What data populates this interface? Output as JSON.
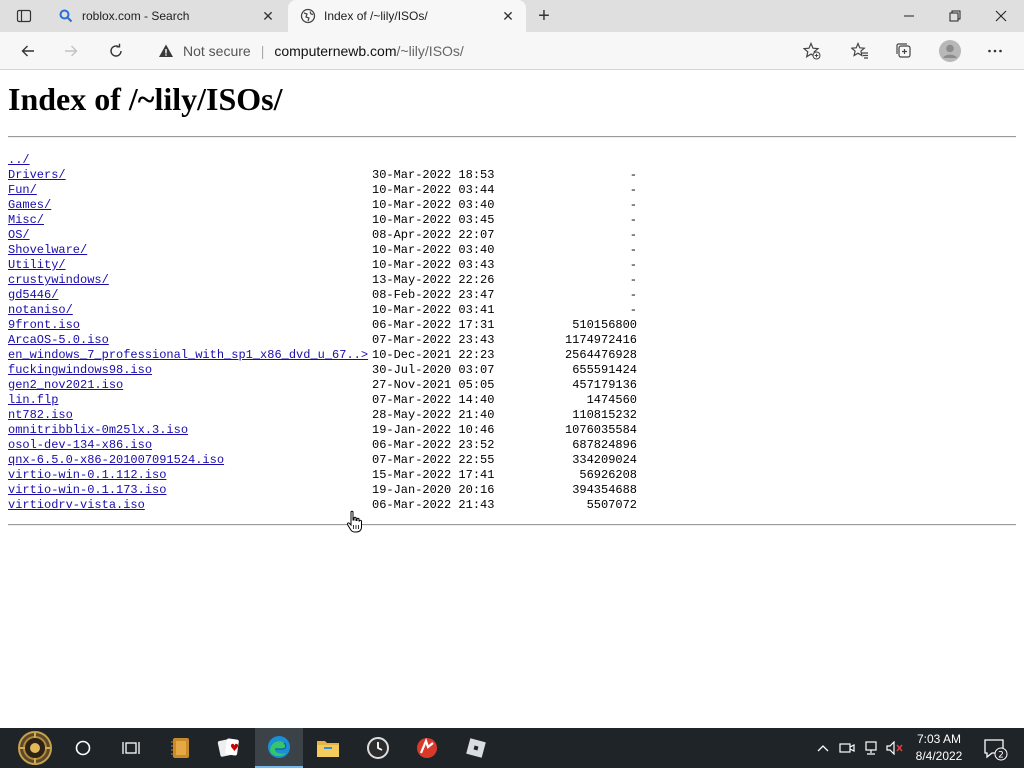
{
  "browser": {
    "tabs": [
      {
        "title": "roblox.com - Search",
        "active": false,
        "icon": "search-icon"
      },
      {
        "title": "Index of /~lily/ISOs/",
        "active": true,
        "icon": "globe-icon"
      }
    ],
    "address_bar": {
      "security_label": "Not secure",
      "url_host": "computernewb.com",
      "url_path": "/~lily/ISOs/"
    }
  },
  "page": {
    "title": "Index of /~lily/ISOs/",
    "parent_link": "../",
    "entries": [
      {
        "name": "Drivers/",
        "date": "30-Mar-2022 18:53",
        "size": "-"
      },
      {
        "name": "Fun/",
        "date": "10-Mar-2022 03:44",
        "size": "-"
      },
      {
        "name": "Games/",
        "date": "10-Mar-2022 03:40",
        "size": "-"
      },
      {
        "name": "Misc/",
        "date": "10-Mar-2022 03:45",
        "size": "-"
      },
      {
        "name": "OS/",
        "date": "08-Apr-2022 22:07",
        "size": "-"
      },
      {
        "name": "Shovelware/",
        "date": "10-Mar-2022 03:40",
        "size": "-"
      },
      {
        "name": "Utility/",
        "date": "10-Mar-2022 03:43",
        "size": "-"
      },
      {
        "name": "crustywindows/",
        "date": "13-May-2022 22:26",
        "size": "-"
      },
      {
        "name": "gd5446/",
        "date": "08-Feb-2022 23:47",
        "size": "-"
      },
      {
        "name": "notaniso/",
        "date": "10-Mar-2022 03:41",
        "size": "-"
      },
      {
        "name": "9front.iso",
        "date": "06-Mar-2022 17:31",
        "size": "510156800"
      },
      {
        "name": "ArcaOS-5.0.iso",
        "date": "07-Mar-2022 23:43",
        "size": "1174972416"
      },
      {
        "name": "en_windows_7_professional_with_sp1_x86_dvd_u_67..>",
        "date": "10-Dec-2021 22:23",
        "size": "2564476928"
      },
      {
        "name": "fuckingwindows98.iso",
        "date": "30-Jul-2020 03:07",
        "size": "655591424"
      },
      {
        "name": "gen2_nov2021.iso",
        "date": "27-Nov-2021 05:05",
        "size": "457179136"
      },
      {
        "name": "lin.flp",
        "date": "07-Mar-2022 14:40",
        "size": "1474560"
      },
      {
        "name": "nt782.iso",
        "date": "28-May-2022 21:40",
        "size": "110815232"
      },
      {
        "name": "omnitribblix-0m25lx.3.iso",
        "date": "19-Jan-2022 10:46",
        "size": "1076035584"
      },
      {
        "name": "osol-dev-134-x86.iso",
        "date": "06-Mar-2022 23:52",
        "size": "687824896"
      },
      {
        "name": "qnx-6.5.0-x86-201007091524.iso",
        "date": "07-Mar-2022 22:55",
        "size": "334209024"
      },
      {
        "name": "virtio-win-0.1.112.iso",
        "date": "15-Mar-2022 17:41",
        "size": "56926208"
      },
      {
        "name": "virtio-win-0.1.173.iso",
        "date": "19-Jan-2020 20:16",
        "size": "394354688"
      },
      {
        "name": "virtiodrv-vista.iso",
        "date": "06-Mar-2022 21:43",
        "size": "5507072"
      }
    ]
  },
  "taskbar": {
    "items": [
      "start-orb-icon",
      "cortana-icon",
      "task-view-icon",
      "notebook-app-icon",
      "solitaire-icon",
      "edge-icon",
      "file-explorer-icon",
      "clock-app-icon",
      "winamp-icon",
      "roblox-icon"
    ],
    "time": "7:03 AM",
    "date": "8/4/2022",
    "notification_count": "2"
  },
  "colors": {
    "link": "#1a0dab",
    "tabstrip": "#dfdfdf",
    "toolbar": "#f7f7f7",
    "taskbar": "#1f2428"
  }
}
